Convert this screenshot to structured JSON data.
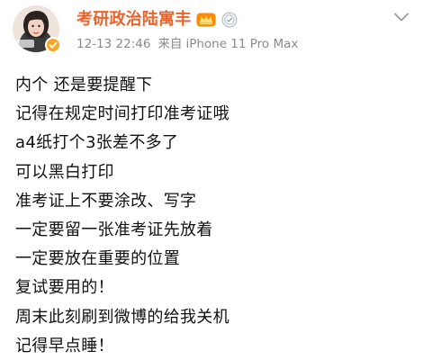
{
  "header": {
    "user_name": "考研政治陆寓丰",
    "timestamp": "12-13 22:46",
    "source_prefix": "来自",
    "device": "iPhone 11 Pro Max",
    "icons": {
      "avatar": "avatar",
      "verified": "verified-badge-icon",
      "vip": "vip-crown-icon",
      "medal": "medal-icon",
      "more": "more-chevron-icon"
    },
    "colors": {
      "name": "#e8642c",
      "meta": "#8a8a8a",
      "badge": "#f5a623"
    }
  },
  "post": {
    "lines": [
      "内个 还是要提醒下",
      "记得在规定时间打印准考证哦",
      "a4纸打个3张差不多了",
      "可以黑白打印",
      "准考证上不要涂改、写字",
      "一定要留一张准考证先放着",
      "一定要放在重要的位置",
      "复试要用的！",
      "周末此刻刷到微博的给我关机",
      "记得早点睡！"
    ]
  }
}
